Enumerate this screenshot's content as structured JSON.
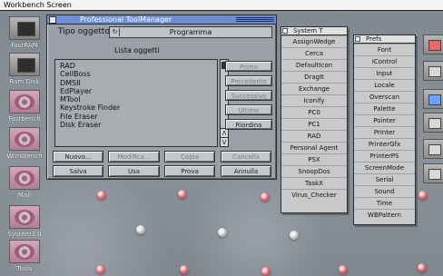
{
  "screen": {
    "title": "Workbench Screen"
  },
  "dock": [
    {
      "label": "FastRAM",
      "icon": "ram-icon"
    },
    {
      "label": "Ram Disk",
      "icon": "ram-disk-icon"
    },
    {
      "label": "Fastbench",
      "icon": "disk-icon"
    },
    {
      "label": "Workbench",
      "icon": "disk-icon"
    },
    {
      "label": "Mail",
      "icon": "disk-icon"
    },
    {
      "label": "System3.0",
      "icon": "disk-icon"
    },
    {
      "label": "Tools",
      "icon": "disk-icon"
    }
  ],
  "window": {
    "title": "Professional ToolManager",
    "type_label": "Tipo oggetto",
    "type_value": "Programma",
    "list_title": "Lista oggetti",
    "items": [
      "RAD",
      "CellBoss",
      "DMSII",
      "EdPlayer",
      "MTool",
      "Keystroke Finder",
      "File Eraser",
      "Disk Eraser"
    ],
    "side_buttons": [
      {
        "label": "Primo",
        "enabled": false
      },
      {
        "label": "Precedente",
        "enabled": false
      },
      {
        "label": "Successivo",
        "enabled": false
      },
      {
        "label": "Ultimo",
        "enabled": false
      },
      {
        "label": "Riordina",
        "enabled": true
      }
    ],
    "bottom_row_1": [
      {
        "label": "Nuovo...",
        "enabled": true
      },
      {
        "label": "Modifica...",
        "enabled": false
      },
      {
        "label": "Copia",
        "enabled": false
      },
      {
        "label": "Cancella",
        "enabled": false
      }
    ],
    "bottom_row_2": [
      {
        "label": "Salva",
        "enabled": true
      },
      {
        "label": "Usa",
        "enabled": true
      },
      {
        "label": "Prova",
        "enabled": true
      },
      {
        "label": "Annulla",
        "enabled": true
      }
    ]
  },
  "system_menu": {
    "title": "System T",
    "items": [
      "AssignWedge",
      "Cerca",
      "DefaultIcon",
      "DragIt",
      "Exchange",
      "Iconify",
      "PC0",
      "PC1",
      "RAD",
      "Personal Agent",
      "PSX",
      "SnoopDos",
      "TaskX",
      "Virus_Checker"
    ]
  },
  "prefs_menu": {
    "title": "Prefs",
    "items": [
      "Font",
      "IControl",
      "Input",
      "Locale",
      "Overscan",
      "Palette",
      "Pointer",
      "Printer",
      "PrinterGfx",
      "PrinterPS",
      "ScreenMode",
      "Serial",
      "Sound",
      "Time",
      "WBPattern"
    ]
  },
  "right_icons": [
    {
      "icon": "tool-icon",
      "color": "#e66"
    },
    {
      "icon": "printer-icon",
      "color": "#d8d8d8"
    },
    {
      "icon": "globe-icon",
      "color": "#6aa0ff"
    },
    {
      "icon": "diamond-icon",
      "color": "#d8d8d8"
    },
    {
      "icon": "chart-icon",
      "color": "#d8d8d8"
    },
    {
      "icon": "window-icon",
      "color": "#d8d8d8"
    }
  ]
}
